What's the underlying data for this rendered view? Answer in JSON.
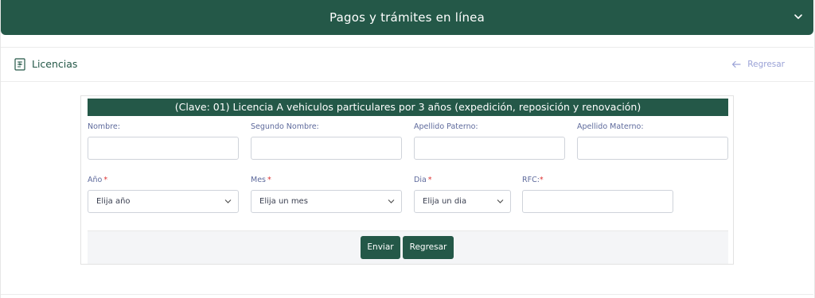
{
  "topbar": {
    "title": "Pagos y trámites en línea"
  },
  "section": {
    "title": "Licencias",
    "back_label": "Regresar"
  },
  "form": {
    "title": "(Clave: 01) Licencia A vehiculos particulares por 3 años (expedición, reposición y renovación)",
    "labels": {
      "nombre": "Nombre:",
      "segundo_nombre": "Segundo Nombre:",
      "apellido_paterno": "Apellido Paterno:",
      "apellido_materno": "Apellido Materno:",
      "anio": "Año",
      "mes": "Mes",
      "dia": "Dia",
      "rfc": "RFC:"
    },
    "required_mark": "*",
    "values": {
      "nombre": "",
      "segundo_nombre": "",
      "apellido_paterno": "",
      "apellido_materno": "",
      "rfc": ""
    },
    "selects": {
      "anio": "Elija año",
      "mes": "Elija un mes",
      "dia": "Elija un dia"
    },
    "buttons": {
      "submit": "Enviar",
      "back": "Regresar"
    }
  },
  "colors": {
    "primary": "#245848",
    "label": "#5e6a9c",
    "back_link": "#9aa2d6",
    "required": "#dd3333"
  },
  "icons": {
    "topbar": "chevron-down-icon",
    "section": "document-icon",
    "back": "arrow-left-icon",
    "select": "caret-down-icon"
  }
}
